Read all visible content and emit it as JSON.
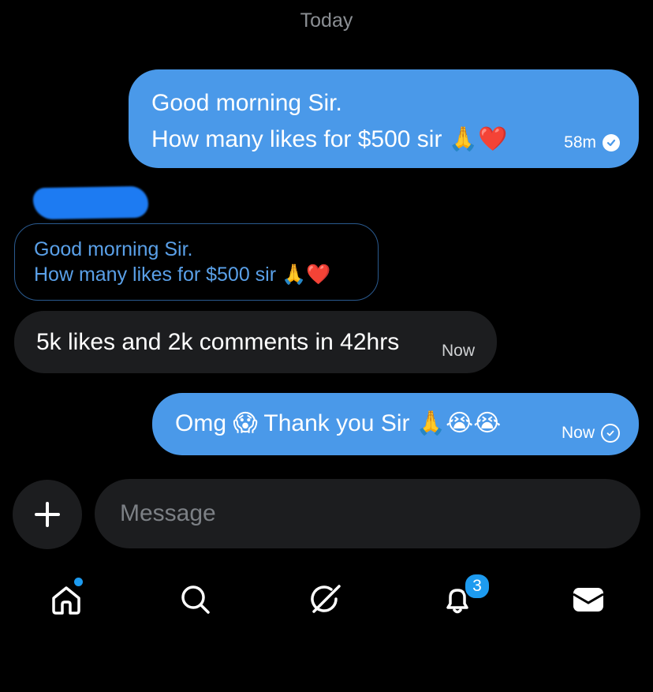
{
  "conversation": {
    "date_separator": "Today",
    "sender_name": "",
    "messages": [
      {
        "direction": "outgoing",
        "lines": [
          "Good morning Sir.",
          "How many likes for $500 sir 🙏❤️"
        ],
        "time": "58m",
        "status": "read"
      },
      {
        "direction": "incoming",
        "quoted_lines": [
          "Good morning Sir.",
          "How many likes for $500 sir 🙏❤️"
        ],
        "text": "5k likes and 2k comments in 42hrs",
        "time": "Now"
      },
      {
        "direction": "outgoing",
        "text": "Omg 😱 Thank you Sir 🙏😭😭",
        "time": "Now",
        "status": "sent"
      }
    ]
  },
  "composer": {
    "add_icon": "plus-icon",
    "placeholder": "Message"
  },
  "nav": {
    "items": [
      {
        "icon": "home-icon",
        "has_dot": true
      },
      {
        "icon": "search-icon"
      },
      {
        "icon": "grok-icon"
      },
      {
        "icon": "bell-icon",
        "badge": "3"
      },
      {
        "icon": "mail-icon"
      }
    ]
  },
  "colors": {
    "background": "#000000",
    "outgoing_bubble": "#4a99e9",
    "incoming_bubble": "#1c1d1f",
    "accent": "#1d9bf0",
    "quoted_text": "#5aa0e8"
  }
}
